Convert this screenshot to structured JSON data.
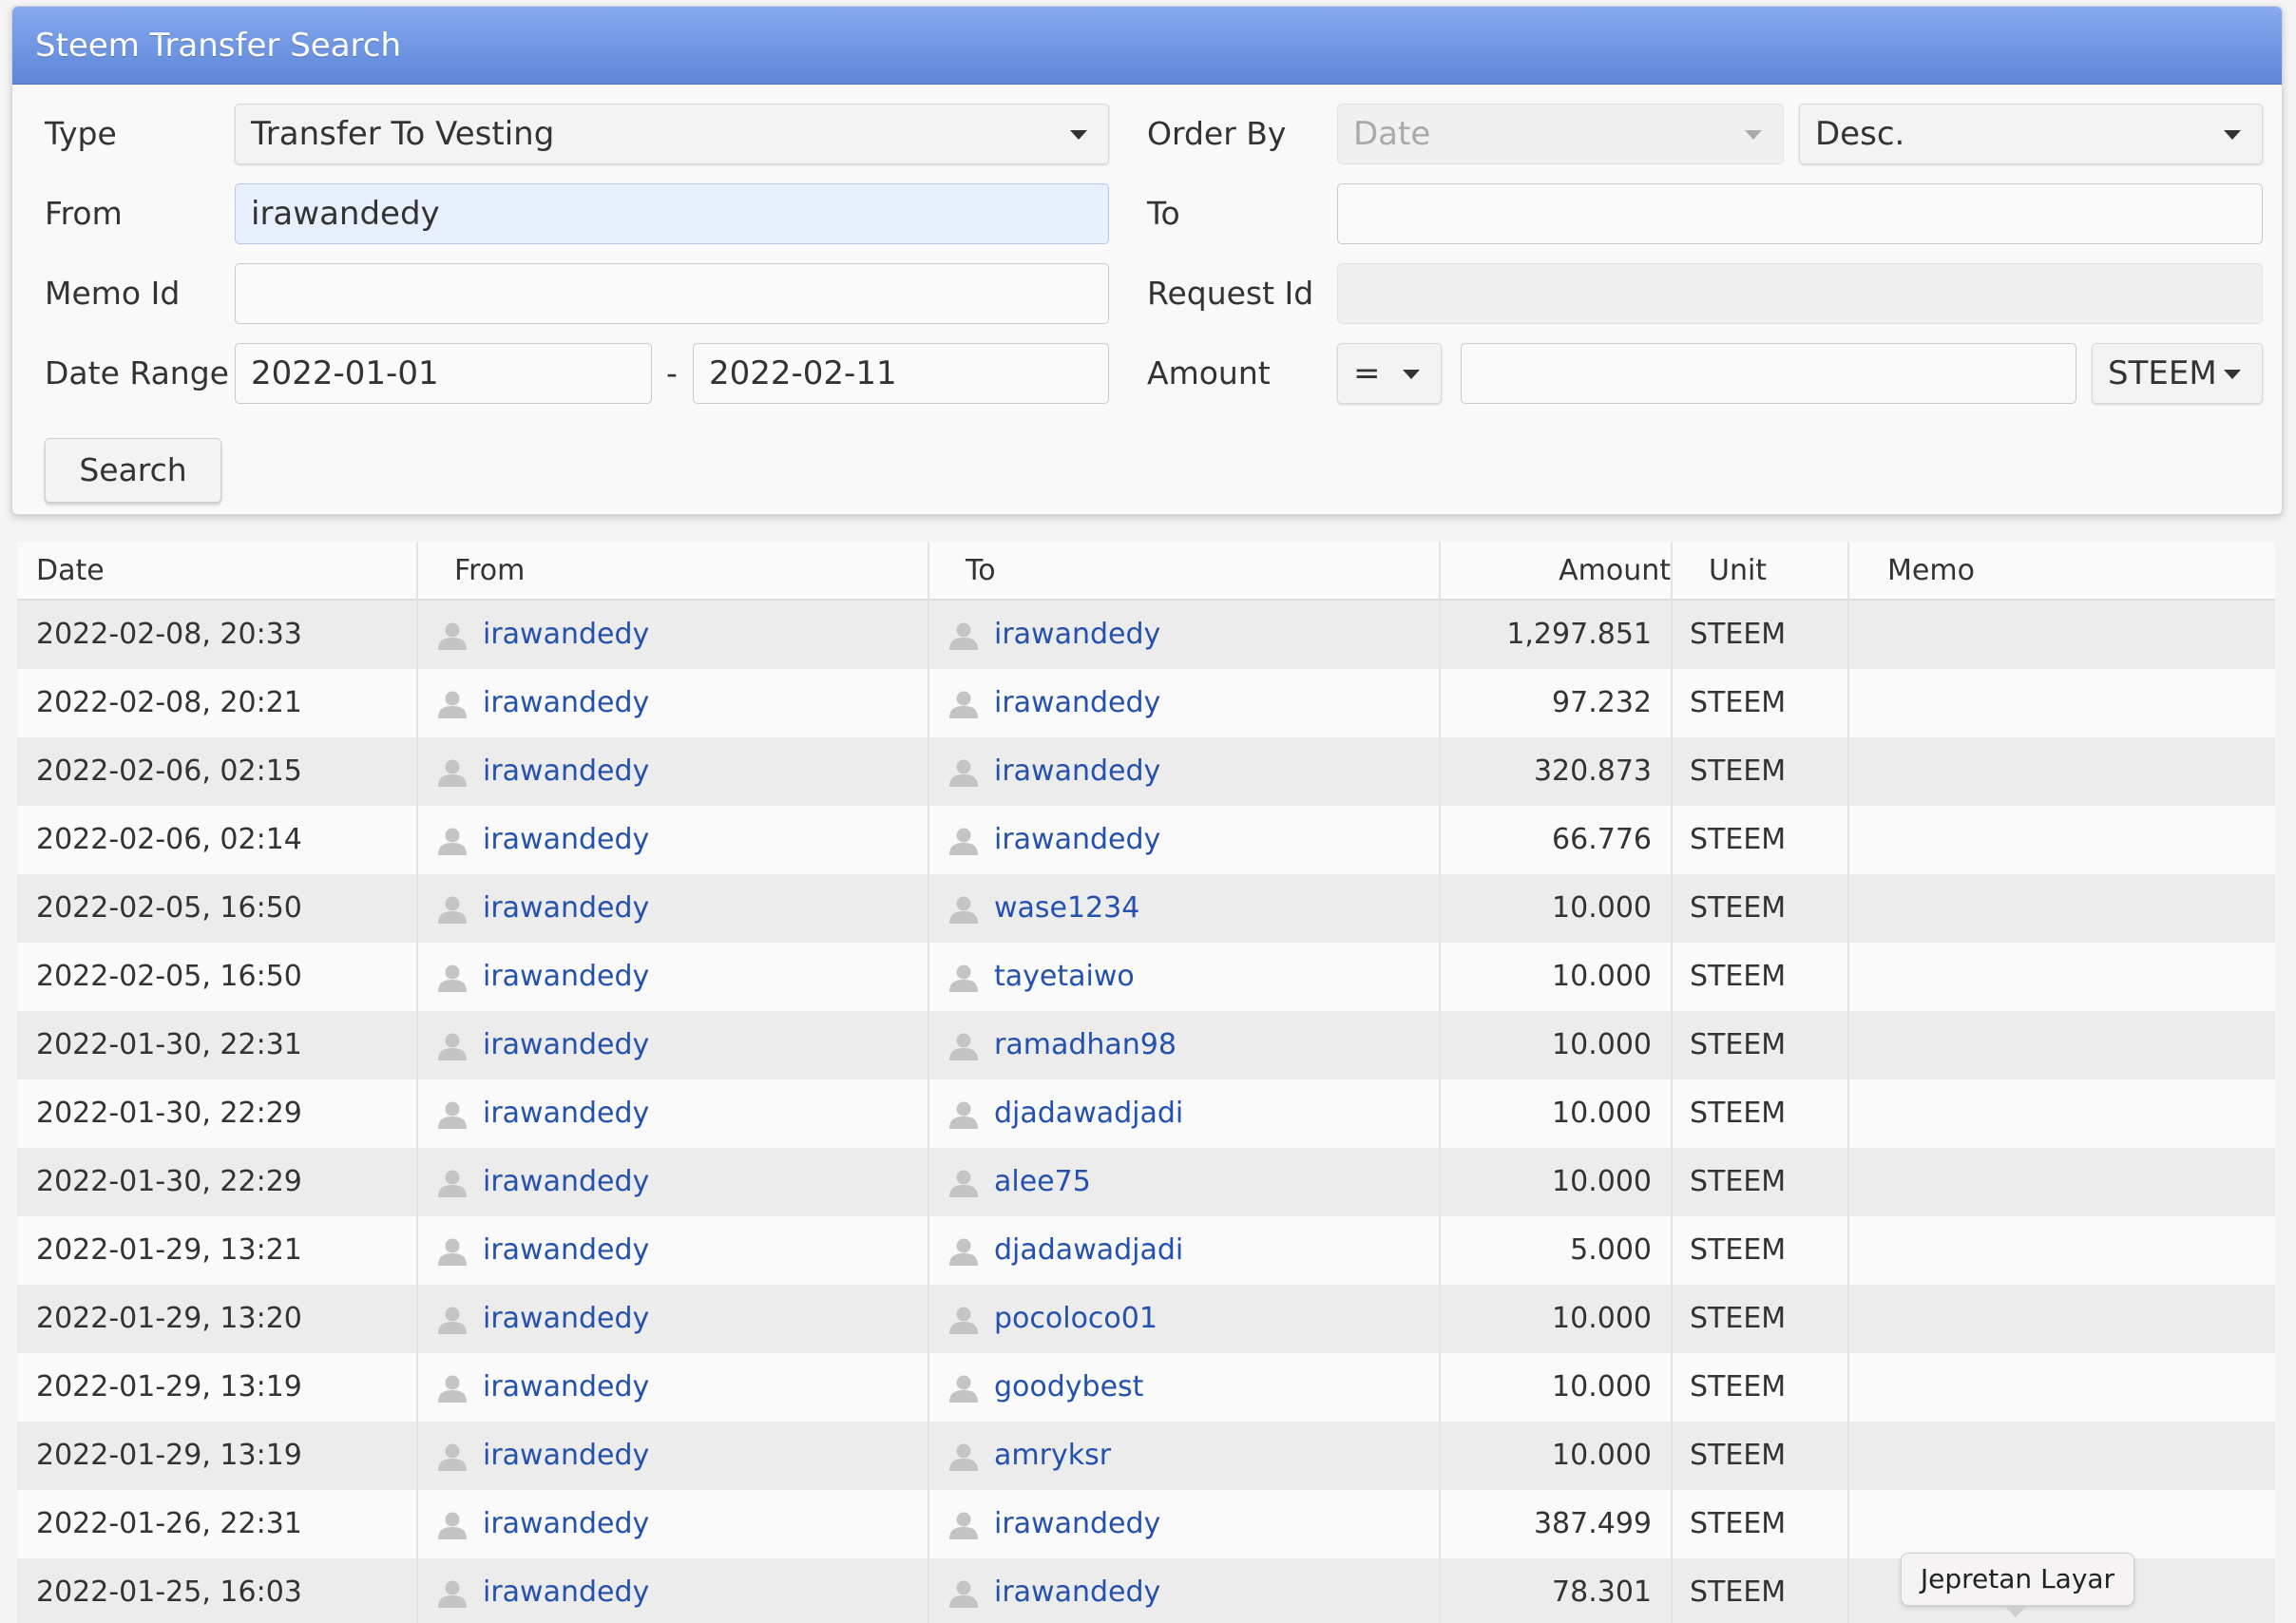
{
  "panel": {
    "title": "Steem Transfer Search",
    "labels": {
      "type": "Type",
      "from": "From",
      "memo_id": "Memo Id",
      "date_range": "Date Range",
      "order_by": "Order By",
      "to": "To",
      "request_id": "Request Id",
      "amount": "Amount",
      "range_separator": "-"
    },
    "type_value": "Transfer To Vesting",
    "from_value": "irawandedy",
    "memo_id_value": "",
    "date_from": "2022-01-01",
    "date_to": "2022-02-11",
    "order_by_value": "Date",
    "order_dir_value": "Desc.",
    "to_value": "",
    "request_id_value": "",
    "amount_operator": "=",
    "amount_value": "",
    "amount_unit": "STEEM",
    "search_label": "Search"
  },
  "table": {
    "headers": {
      "date": "Date",
      "from": "From",
      "to": "To",
      "amount": "Amount",
      "unit": "Unit",
      "memo": "Memo"
    },
    "rows": [
      {
        "date": "2022-02-08, 20:33",
        "from": "irawandedy",
        "to": "irawandedy",
        "amount": "1,297.851",
        "unit": "STEEM",
        "memo": ""
      },
      {
        "date": "2022-02-08, 20:21",
        "from": "irawandedy",
        "to": "irawandedy",
        "amount": "97.232",
        "unit": "STEEM",
        "memo": ""
      },
      {
        "date": "2022-02-06, 02:15",
        "from": "irawandedy",
        "to": "irawandedy",
        "amount": "320.873",
        "unit": "STEEM",
        "memo": ""
      },
      {
        "date": "2022-02-06, 02:14",
        "from": "irawandedy",
        "to": "irawandedy",
        "amount": "66.776",
        "unit": "STEEM",
        "memo": ""
      },
      {
        "date": "2022-02-05, 16:50",
        "from": "irawandedy",
        "to": "wase1234",
        "amount": "10.000",
        "unit": "STEEM",
        "memo": ""
      },
      {
        "date": "2022-02-05, 16:50",
        "from": "irawandedy",
        "to": "tayetaiwo",
        "amount": "10.000",
        "unit": "STEEM",
        "memo": ""
      },
      {
        "date": "2022-01-30, 22:31",
        "from": "irawandedy",
        "to": "ramadhan98",
        "amount": "10.000",
        "unit": "STEEM",
        "memo": ""
      },
      {
        "date": "2022-01-30, 22:29",
        "from": "irawandedy",
        "to": "djadawadjadi",
        "amount": "10.000",
        "unit": "STEEM",
        "memo": ""
      },
      {
        "date": "2022-01-30, 22:29",
        "from": "irawandedy",
        "to": "alee75",
        "amount": "10.000",
        "unit": "STEEM",
        "memo": ""
      },
      {
        "date": "2022-01-29, 13:21",
        "from": "irawandedy",
        "to": "djadawadjadi",
        "amount": "5.000",
        "unit": "STEEM",
        "memo": ""
      },
      {
        "date": "2022-01-29, 13:20",
        "from": "irawandedy",
        "to": "pocoloco01",
        "amount": "10.000",
        "unit": "STEEM",
        "memo": ""
      },
      {
        "date": "2022-01-29, 13:19",
        "from": "irawandedy",
        "to": "goodybest",
        "amount": "10.000",
        "unit": "STEEM",
        "memo": ""
      },
      {
        "date": "2022-01-29, 13:19",
        "from": "irawandedy",
        "to": "amryksr",
        "amount": "10.000",
        "unit": "STEEM",
        "memo": ""
      },
      {
        "date": "2022-01-26, 22:31",
        "from": "irawandedy",
        "to": "irawandedy",
        "amount": "387.499",
        "unit": "STEEM",
        "memo": ""
      },
      {
        "date": "2022-01-25, 16:03",
        "from": "irawandedy",
        "to": "irawandedy",
        "amount": "78.301",
        "unit": "STEEM",
        "memo": ""
      }
    ]
  },
  "tooltip": {
    "text": "Jepretan Layar"
  },
  "icons": {
    "user": "user-icon",
    "dropdown": "chevron-down-icon"
  },
  "colors": {
    "header": "#5d86d8",
    "link": "#2450b0"
  }
}
